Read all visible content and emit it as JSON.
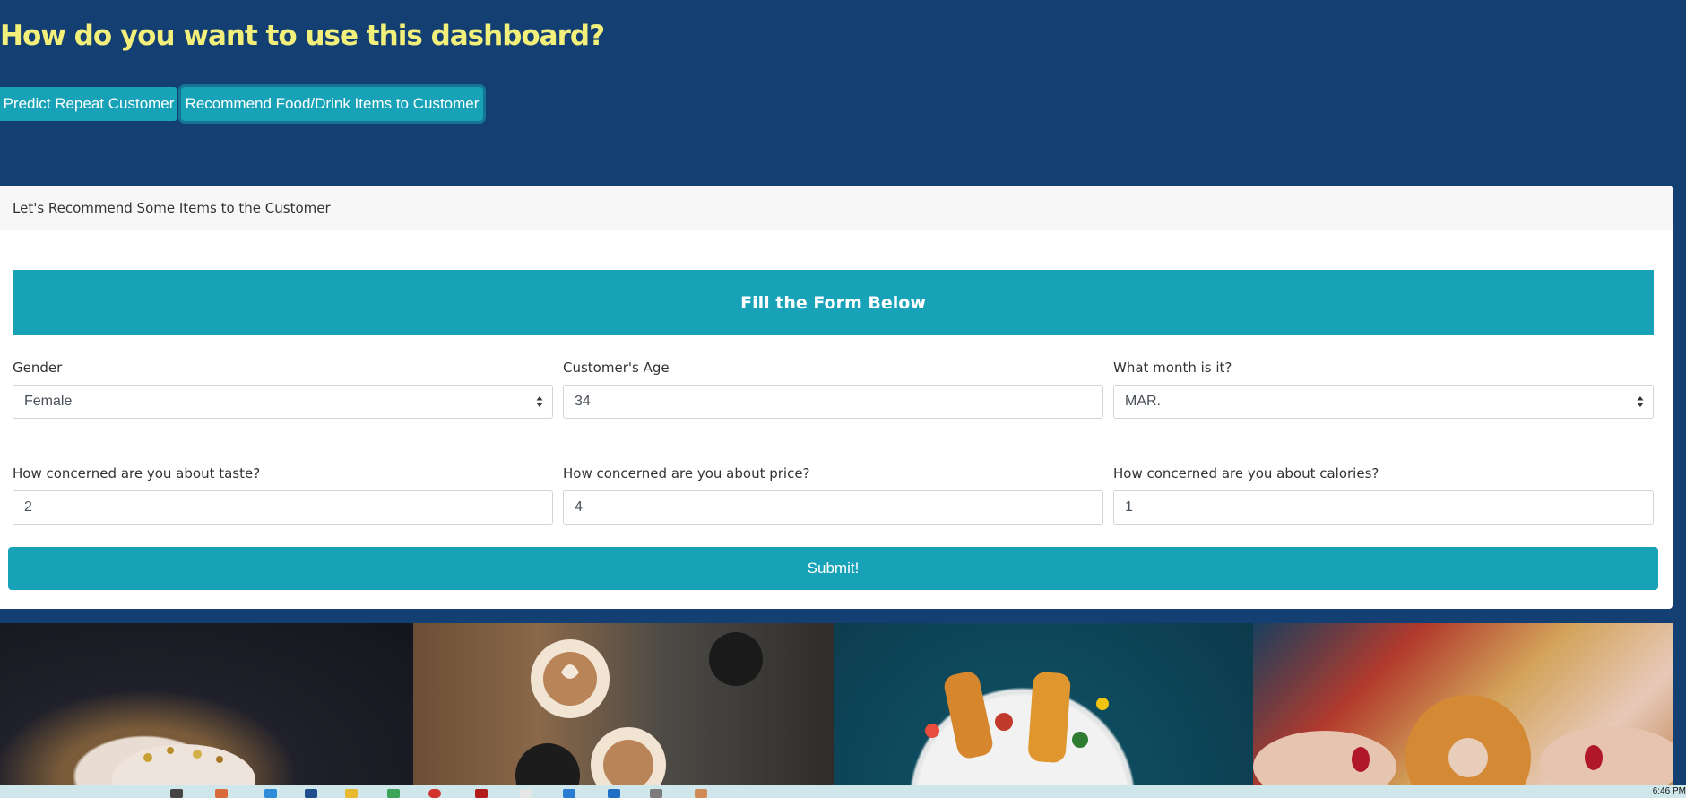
{
  "header": {
    "title": "How do you want to use this dashboard?"
  },
  "mode_buttons": {
    "predict_label": "Predict Repeat Customer",
    "recommend_label": "Recommend Food/Drink Items to Customer"
  },
  "card": {
    "header_title": "Let's Recommend Some Items to the Customer",
    "banner_title": "Fill the Form Below",
    "fields": {
      "gender": {
        "label": "Gender",
        "value": "Female"
      },
      "age": {
        "label": "Customer's Age",
        "value": "34"
      },
      "month": {
        "label": "What month is it?",
        "value": "MAR."
      },
      "taste": {
        "label": "How concerned are you about taste?",
        "value": "2"
      },
      "price": {
        "label": "How concerned are you about price?",
        "value": "4"
      },
      "calories": {
        "label": "How concerned are you about calories?",
        "value": "1"
      }
    },
    "submit_label": "Submit!"
  },
  "gallery": {
    "images": [
      "donut-photo",
      "latte-cups-photo",
      "kebab-plate-photo",
      "glazed-donut-hands-photo"
    ]
  },
  "taskbar": {
    "clock": "6:46 PM"
  },
  "colors": {
    "page_bg": "#133f73",
    "headline": "#f2f07a",
    "accent": "#17a2b8"
  }
}
